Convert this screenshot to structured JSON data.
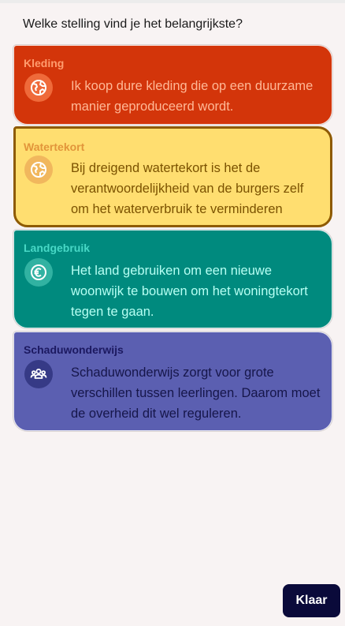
{
  "question": "Welke stelling vind je het belangrijkste?",
  "cards": [
    {
      "category": "Kleding",
      "icon": "globe-icon",
      "statement": "Ik koop dure kleding die op een duurzame manier geproduceerd wordt.",
      "color": "#d3350a",
      "selected": false
    },
    {
      "category": "Watertekort",
      "icon": "globe-icon",
      "statement": "Bij dreigend watertekort is het de verantwoordelijkheid van de burgers zelf om het waterverbruik te verminderen",
      "color": "#ffde70",
      "selected": true
    },
    {
      "category": "Landgebruik",
      "icon": "euro-icon",
      "statement": "Het land gebruiken om een nieuwe woonwijk te bouwen om het woningtekort tegen te gaan.",
      "color": "#008a7e",
      "selected": false
    },
    {
      "category": "Schaduwonderwijs",
      "icon": "people-icon",
      "statement": "Schaduwonderwijs zorgt voor grote verschillen tussen leerlingen. Daarom moet de overheid dit wel reguleren.",
      "color": "#5b5fb1",
      "selected": false
    }
  ],
  "button": {
    "label": "Klaar"
  }
}
